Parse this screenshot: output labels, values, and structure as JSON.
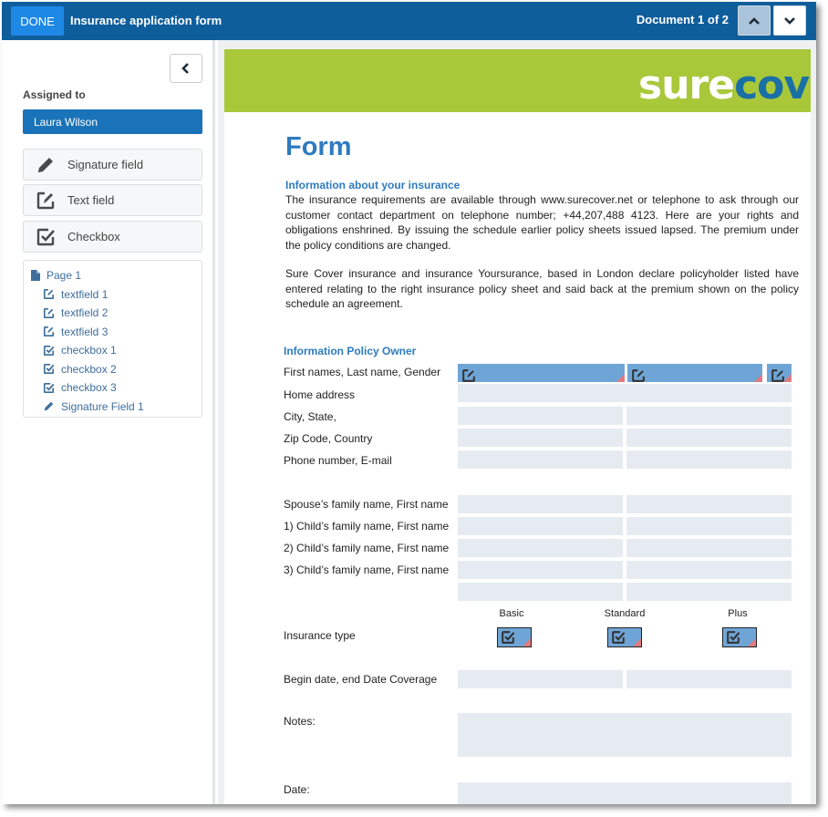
{
  "topbar": {
    "done_label": "DONE",
    "title": "Insurance application form",
    "document_counter": "Document 1 of 2",
    "prev_icon": "chevron-up-icon",
    "next_icon": "chevron-down-icon"
  },
  "sidebar": {
    "collapse_icon": "chevron-left-icon",
    "assigned_label": "Assigned to",
    "assignee": "Laura Wilson",
    "tools": [
      {
        "label": "Signature field",
        "icon": "pencil-icon"
      },
      {
        "label": "Text field",
        "icon": "text-field-icon"
      },
      {
        "label": "Checkbox",
        "icon": "checkbox-icon"
      }
    ],
    "tree": {
      "page": "Page 1",
      "items": [
        {
          "label": "textfield 1",
          "icon": "text-field-icon"
        },
        {
          "label": "textfield 2",
          "icon": "text-field-icon"
        },
        {
          "label": "textfield 3",
          "icon": "text-field-icon"
        },
        {
          "label": "checkbox 1",
          "icon": "checkbox-icon"
        },
        {
          "label": "checkbox 2",
          "icon": "checkbox-icon"
        },
        {
          "label": "checkbox 3",
          "icon": "checkbox-icon"
        },
        {
          "label": "Signature Field 1",
          "icon": "pencil-icon"
        }
      ]
    }
  },
  "document": {
    "logo_white": "sure",
    "logo_blue": "cov",
    "form_title": "Form",
    "section1_title": "Information about your insurance",
    "para1": "The insurance requirements are available through www.surecover.net or telephone to ask through our customer contact department on telephone number; +44,207,488 4123. Here are your rights and obligations enshrined. By issuing the schedule earlier policy sheets issued lapsed. The premium under the policy conditions are changed.",
    "para2": "Sure Cover insurance and insurance Yoursurance, based in London declare policyholder listed have entered relating to the right insurance policy sheet and said back at the premium shown on the policy schedule an agreement.",
    "section2_title": "Information Policy Owner",
    "labels": {
      "names": "First names, Last name, Gender",
      "address": "Home address",
      "city": "City, State,",
      "zip": "Zip Code, Country",
      "phone": "Phone number, E-mail",
      "spouse": "Spouse’s family name, First name",
      "child1": "1) Child’s family name, First name",
      "child2": "2) Child’s family name, First name",
      "child3": "3) Child’s family name, First name",
      "insurance_type": "Insurance type",
      "begin_date": "Begin date, end Date Coverage",
      "notes": "Notes:",
      "date": "Date:"
    },
    "plan_columns": [
      "Basic",
      "Standard",
      "Plus"
    ],
    "colors": {
      "field_fill": "#6fa5d6",
      "empty_box": "#e6ebf2",
      "banner": "#a8c83a",
      "title_blue": "#2e7bbf"
    }
  }
}
